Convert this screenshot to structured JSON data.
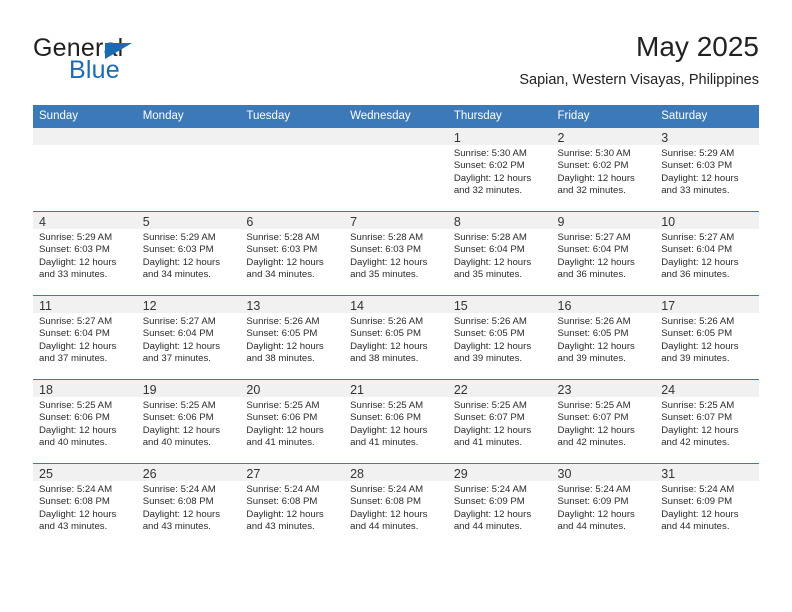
{
  "brand": {
    "name_top": "General",
    "name_bottom": "Blue",
    "accent_color": "#1a6bb5"
  },
  "header": {
    "title": "May 2025",
    "subtitle": "Sapian, Western Visayas, Philippines"
  },
  "theme": {
    "header_blue": "#3b79b8",
    "daynum_band": "#f1f1f1",
    "text": "#2b2b2b"
  },
  "weekdays": [
    "Sunday",
    "Monday",
    "Tuesday",
    "Wednesday",
    "Thursday",
    "Friday",
    "Saturday"
  ],
  "labels": {
    "sunrise_prefix": "Sunrise:",
    "sunset_prefix": "Sunset:",
    "daylight_prefix": "Daylight:"
  },
  "weeks": [
    [
      {
        "day": "",
        "empty": true,
        "lines": []
      },
      {
        "day": "",
        "empty": true,
        "lines": []
      },
      {
        "day": "",
        "empty": true,
        "lines": []
      },
      {
        "day": "",
        "empty": true,
        "lines": []
      },
      {
        "day": "1",
        "empty": false,
        "lines": [
          "Sunrise: 5:30 AM",
          "Sunset: 6:02 PM",
          "Daylight: 12 hours",
          "and 32 minutes."
        ]
      },
      {
        "day": "2",
        "empty": false,
        "lines": [
          "Sunrise: 5:30 AM",
          "Sunset: 6:02 PM",
          "Daylight: 12 hours",
          "and 32 minutes."
        ]
      },
      {
        "day": "3",
        "empty": false,
        "lines": [
          "Sunrise: 5:29 AM",
          "Sunset: 6:03 PM",
          "Daylight: 12 hours",
          "and 33 minutes."
        ]
      }
    ],
    [
      {
        "day": "4",
        "empty": false,
        "lines": [
          "Sunrise: 5:29 AM",
          "Sunset: 6:03 PM",
          "Daylight: 12 hours",
          "and 33 minutes."
        ]
      },
      {
        "day": "5",
        "empty": false,
        "lines": [
          "Sunrise: 5:29 AM",
          "Sunset: 6:03 PM",
          "Daylight: 12 hours",
          "and 34 minutes."
        ]
      },
      {
        "day": "6",
        "empty": false,
        "lines": [
          "Sunrise: 5:28 AM",
          "Sunset: 6:03 PM",
          "Daylight: 12 hours",
          "and 34 minutes."
        ]
      },
      {
        "day": "7",
        "empty": false,
        "lines": [
          "Sunrise: 5:28 AM",
          "Sunset: 6:03 PM",
          "Daylight: 12 hours",
          "and 35 minutes."
        ]
      },
      {
        "day": "8",
        "empty": false,
        "lines": [
          "Sunrise: 5:28 AM",
          "Sunset: 6:04 PM",
          "Daylight: 12 hours",
          "and 35 minutes."
        ]
      },
      {
        "day": "9",
        "empty": false,
        "lines": [
          "Sunrise: 5:27 AM",
          "Sunset: 6:04 PM",
          "Daylight: 12 hours",
          "and 36 minutes."
        ]
      },
      {
        "day": "10",
        "empty": false,
        "lines": [
          "Sunrise: 5:27 AM",
          "Sunset: 6:04 PM",
          "Daylight: 12 hours",
          "and 36 minutes."
        ]
      }
    ],
    [
      {
        "day": "11",
        "empty": false,
        "lines": [
          "Sunrise: 5:27 AM",
          "Sunset: 6:04 PM",
          "Daylight: 12 hours",
          "and 37 minutes."
        ]
      },
      {
        "day": "12",
        "empty": false,
        "lines": [
          "Sunrise: 5:27 AM",
          "Sunset: 6:04 PM",
          "Daylight: 12 hours",
          "and 37 minutes."
        ]
      },
      {
        "day": "13",
        "empty": false,
        "lines": [
          "Sunrise: 5:26 AM",
          "Sunset: 6:05 PM",
          "Daylight: 12 hours",
          "and 38 minutes."
        ]
      },
      {
        "day": "14",
        "empty": false,
        "lines": [
          "Sunrise: 5:26 AM",
          "Sunset: 6:05 PM",
          "Daylight: 12 hours",
          "and 38 minutes."
        ]
      },
      {
        "day": "15",
        "empty": false,
        "lines": [
          "Sunrise: 5:26 AM",
          "Sunset: 6:05 PM",
          "Daylight: 12 hours",
          "and 39 minutes."
        ]
      },
      {
        "day": "16",
        "empty": false,
        "lines": [
          "Sunrise: 5:26 AM",
          "Sunset: 6:05 PM",
          "Daylight: 12 hours",
          "and 39 minutes."
        ]
      },
      {
        "day": "17",
        "empty": false,
        "lines": [
          "Sunrise: 5:26 AM",
          "Sunset: 6:05 PM",
          "Daylight: 12 hours",
          "and 39 minutes."
        ]
      }
    ],
    [
      {
        "day": "18",
        "empty": false,
        "lines": [
          "Sunrise: 5:25 AM",
          "Sunset: 6:06 PM",
          "Daylight: 12 hours",
          "and 40 minutes."
        ]
      },
      {
        "day": "19",
        "empty": false,
        "lines": [
          "Sunrise: 5:25 AM",
          "Sunset: 6:06 PM",
          "Daylight: 12 hours",
          "and 40 minutes."
        ]
      },
      {
        "day": "20",
        "empty": false,
        "lines": [
          "Sunrise: 5:25 AM",
          "Sunset: 6:06 PM",
          "Daylight: 12 hours",
          "and 41 minutes."
        ]
      },
      {
        "day": "21",
        "empty": false,
        "lines": [
          "Sunrise: 5:25 AM",
          "Sunset: 6:06 PM",
          "Daylight: 12 hours",
          "and 41 minutes."
        ]
      },
      {
        "day": "22",
        "empty": false,
        "lines": [
          "Sunrise: 5:25 AM",
          "Sunset: 6:07 PM",
          "Daylight: 12 hours",
          "and 41 minutes."
        ]
      },
      {
        "day": "23",
        "empty": false,
        "lines": [
          "Sunrise: 5:25 AM",
          "Sunset: 6:07 PM",
          "Daylight: 12 hours",
          "and 42 minutes."
        ]
      },
      {
        "day": "24",
        "empty": false,
        "lines": [
          "Sunrise: 5:25 AM",
          "Sunset: 6:07 PM",
          "Daylight: 12 hours",
          "and 42 minutes."
        ]
      }
    ],
    [
      {
        "day": "25",
        "empty": false,
        "lines": [
          "Sunrise: 5:24 AM",
          "Sunset: 6:08 PM",
          "Daylight: 12 hours",
          "and 43 minutes."
        ]
      },
      {
        "day": "26",
        "empty": false,
        "lines": [
          "Sunrise: 5:24 AM",
          "Sunset: 6:08 PM",
          "Daylight: 12 hours",
          "and 43 minutes."
        ]
      },
      {
        "day": "27",
        "empty": false,
        "lines": [
          "Sunrise: 5:24 AM",
          "Sunset: 6:08 PM",
          "Daylight: 12 hours",
          "and 43 minutes."
        ]
      },
      {
        "day": "28",
        "empty": false,
        "lines": [
          "Sunrise: 5:24 AM",
          "Sunset: 6:08 PM",
          "Daylight: 12 hours",
          "and 44 minutes."
        ]
      },
      {
        "day": "29",
        "empty": false,
        "lines": [
          "Sunrise: 5:24 AM",
          "Sunset: 6:09 PM",
          "Daylight: 12 hours",
          "and 44 minutes."
        ]
      },
      {
        "day": "30",
        "empty": false,
        "lines": [
          "Sunrise: 5:24 AM",
          "Sunset: 6:09 PM",
          "Daylight: 12 hours",
          "and 44 minutes."
        ]
      },
      {
        "day": "31",
        "empty": false,
        "lines": [
          "Sunrise: 5:24 AM",
          "Sunset: 6:09 PM",
          "Daylight: 12 hours",
          "and 44 minutes."
        ]
      }
    ]
  ]
}
